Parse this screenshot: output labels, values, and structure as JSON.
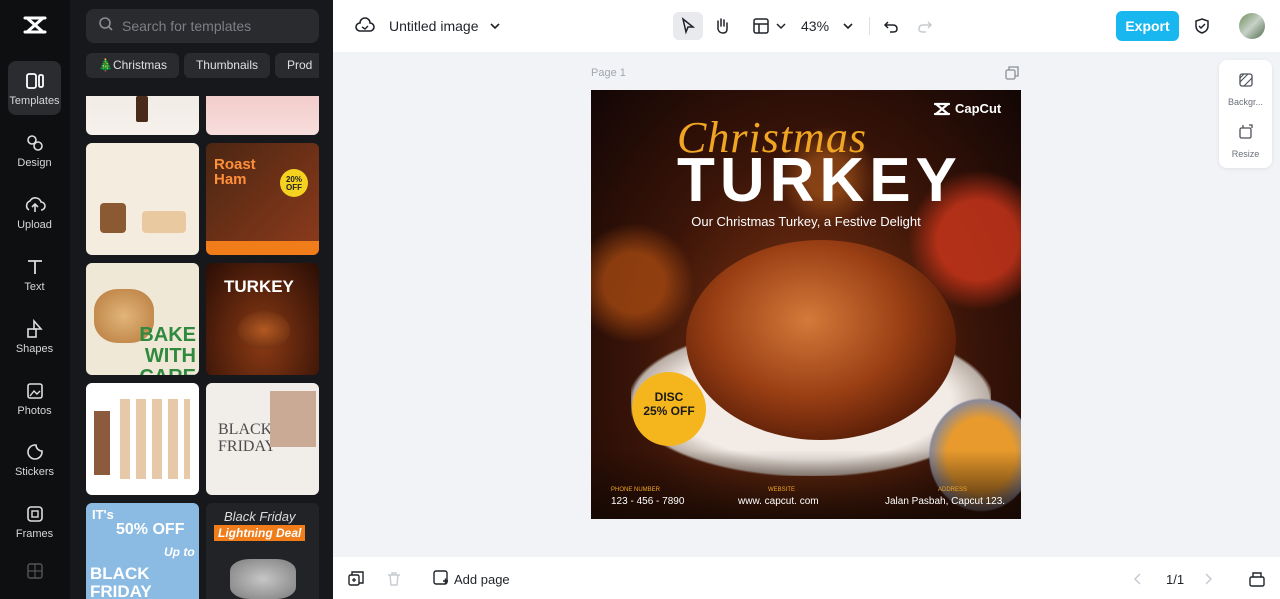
{
  "rail": {
    "items": [
      {
        "label": "Templates",
        "icon": "templates-icon"
      },
      {
        "label": "Design",
        "icon": "design-icon"
      },
      {
        "label": "Upload",
        "icon": "upload-icon"
      },
      {
        "label": "Text",
        "icon": "text-icon"
      },
      {
        "label": "Shapes",
        "icon": "shapes-icon"
      },
      {
        "label": "Photos",
        "icon": "photos-icon"
      },
      {
        "label": "Stickers",
        "icon": "stickers-icon"
      },
      {
        "label": "Frames",
        "icon": "frames-icon"
      }
    ]
  },
  "panel": {
    "search_placeholder": "Search for templates",
    "chips": [
      "🎄Christmas",
      "Thumbnails",
      "Prod"
    ],
    "thumbs": {
      "t3_title": "Roast Ham",
      "t3_badge": "20% OFF",
      "t4_title": "BAKE WITH CARE",
      "t5_title": "TURKEY",
      "t6_title": "BLACK FRIDAY",
      "t8_line1": "IT's",
      "t8_line2": "50% OFF",
      "t8_line3": "Up to",
      "t8_line4": "BLACK FRIDAY",
      "t9_line1": "Black Friday",
      "t9_line2": "Lightning Deal"
    }
  },
  "topbar": {
    "title": "Untitled image",
    "zoom": "43%",
    "export_label": "Export"
  },
  "canvas": {
    "page_label": "Page 1",
    "design": {
      "brand": "CapCut",
      "script_title": "Christmas",
      "main_title": "TURKEY",
      "subtitle": "Our Christmas Turkey, a Festive Delight",
      "badge_line1": "DISC",
      "badge_line2": "25% OFF",
      "footer_left_label": "PHONE NUMBER",
      "footer_left": "123 - 456 - 7890",
      "footer_mid_label": "WEBSITE",
      "footer_mid": "www. capcut. com",
      "footer_right_label": "ADDRESS",
      "footer_right": "Jalan Pasbah, Capcut 123."
    }
  },
  "side_tools": [
    {
      "label": "Backgr...",
      "icon": "background-icon"
    },
    {
      "label": "Resize",
      "icon": "resize-icon"
    }
  ],
  "bottombar": {
    "add_page_label": "Add page",
    "pager": "1/1"
  },
  "colors": {
    "accent": "#18b7ef",
    "rail_bg": "#0e0f11",
    "panel_bg": "#17181b"
  }
}
